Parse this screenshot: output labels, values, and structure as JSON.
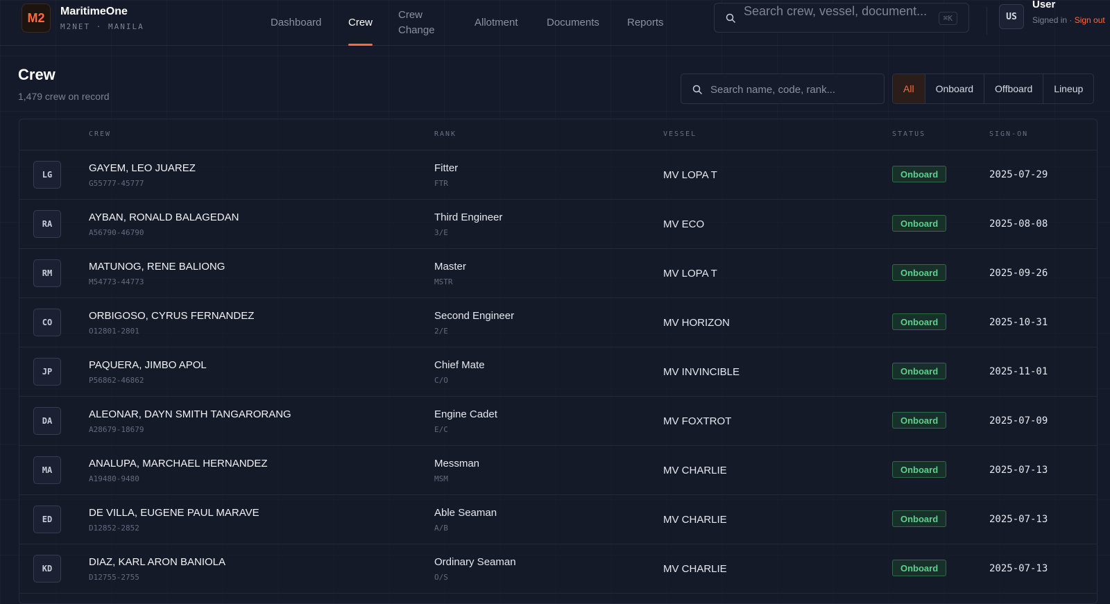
{
  "brand": {
    "logo": "M2",
    "name": "MaritimeOne",
    "sub": "M2NET · MANILA"
  },
  "nav": [
    {
      "label": "Dashboard",
      "active": false
    },
    {
      "label": "Crew",
      "active": true
    },
    {
      "label": "Crew Change",
      "active": false
    },
    {
      "label": "Allotment",
      "active": false
    },
    {
      "label": "Documents",
      "active": false
    },
    {
      "label": "Reports",
      "active": false
    }
  ],
  "global_search": {
    "placeholder": "Search crew, vessel, document...",
    "shortcut": "⌘K"
  },
  "user": {
    "initials": "US",
    "name": "User",
    "status": "Signed in · ",
    "signout": "Sign out"
  },
  "page": {
    "title": "Crew",
    "subtitle": "1,479 crew on record"
  },
  "crew_search": {
    "placeholder": "Search name, code, rank..."
  },
  "filters": [
    {
      "label": "All",
      "active": true
    },
    {
      "label": "Onboard",
      "active": false
    },
    {
      "label": "Offboard",
      "active": false
    },
    {
      "label": "Lineup",
      "active": false
    }
  ],
  "table": {
    "headers": {
      "crew": "CREW",
      "rank": "RANK",
      "vessel": "VESSEL",
      "status": "STATUS",
      "sign_on": "SIGN-ON"
    },
    "rows": [
      {
        "initials": "LG",
        "name": "GAYEM, LEO JUAREZ",
        "code": "G55777-45777",
        "rank": "Fitter",
        "rank_code": "FTR",
        "vessel": "MV LOPA T",
        "status": "Onboard",
        "sign_on": "2025-07-29"
      },
      {
        "initials": "RA",
        "name": "AYBAN, RONALD BALAGEDAN",
        "code": "A56790-46790",
        "rank": "Third Engineer",
        "rank_code": "3/E",
        "vessel": "MV ECO",
        "status": "Onboard",
        "sign_on": "2025-08-08"
      },
      {
        "initials": "RM",
        "name": "MATUNOG, RENE BALIONG",
        "code": "M54773-44773",
        "rank": "Master",
        "rank_code": "MSTR",
        "vessel": "MV LOPA T",
        "status": "Onboard",
        "sign_on": "2025-09-26"
      },
      {
        "initials": "CO",
        "name": "ORBIGOSO, CYRUS FERNANDEZ",
        "code": "O12801-2801",
        "rank": "Second Engineer",
        "rank_code": "2/E",
        "vessel": "MV HORIZON",
        "status": "Onboard",
        "sign_on": "2025-10-31"
      },
      {
        "initials": "JP",
        "name": "PAQUERA, JIMBO APOL",
        "code": "P56862-46862",
        "rank": "Chief Mate",
        "rank_code": "C/O",
        "vessel": "MV INVINCIBLE",
        "status": "Onboard",
        "sign_on": "2025-11-01"
      },
      {
        "initials": "DA",
        "name": "ALEONAR, DAYN SMITH TANGARORANG",
        "code": "A28679-18679",
        "rank": "Engine Cadet",
        "rank_code": "E/C",
        "vessel": "MV FOXTROT",
        "status": "Onboard",
        "sign_on": "2025-07-09"
      },
      {
        "initials": "MA",
        "name": "ANALUPA, MARCHAEL HERNANDEZ",
        "code": "A19480-9480",
        "rank": "Messman",
        "rank_code": "MSM",
        "vessel": "MV CHARLIE",
        "status": "Onboard",
        "sign_on": "2025-07-13"
      },
      {
        "initials": "ED",
        "name": "DE VILLA, EUGENE PAUL MARAVE",
        "code": "D12852-2852",
        "rank": "Able Seaman",
        "rank_code": "A/B",
        "vessel": "MV CHARLIE",
        "status": "Onboard",
        "sign_on": "2025-07-13"
      },
      {
        "initials": "KD",
        "name": "DIAZ, KARL ARON BANIOLA",
        "code": "D12755-2755",
        "rank": "Ordinary Seaman",
        "rank_code": "O/S",
        "vessel": "MV CHARLIE",
        "status": "Onboard",
        "sign_on": "2025-07-13"
      }
    ]
  },
  "colors": {
    "accent": "#ff6a3d",
    "status_onboard": "#5fd08d",
    "background": "#151a2a"
  },
  "icons": {
    "search": "search-icon"
  }
}
